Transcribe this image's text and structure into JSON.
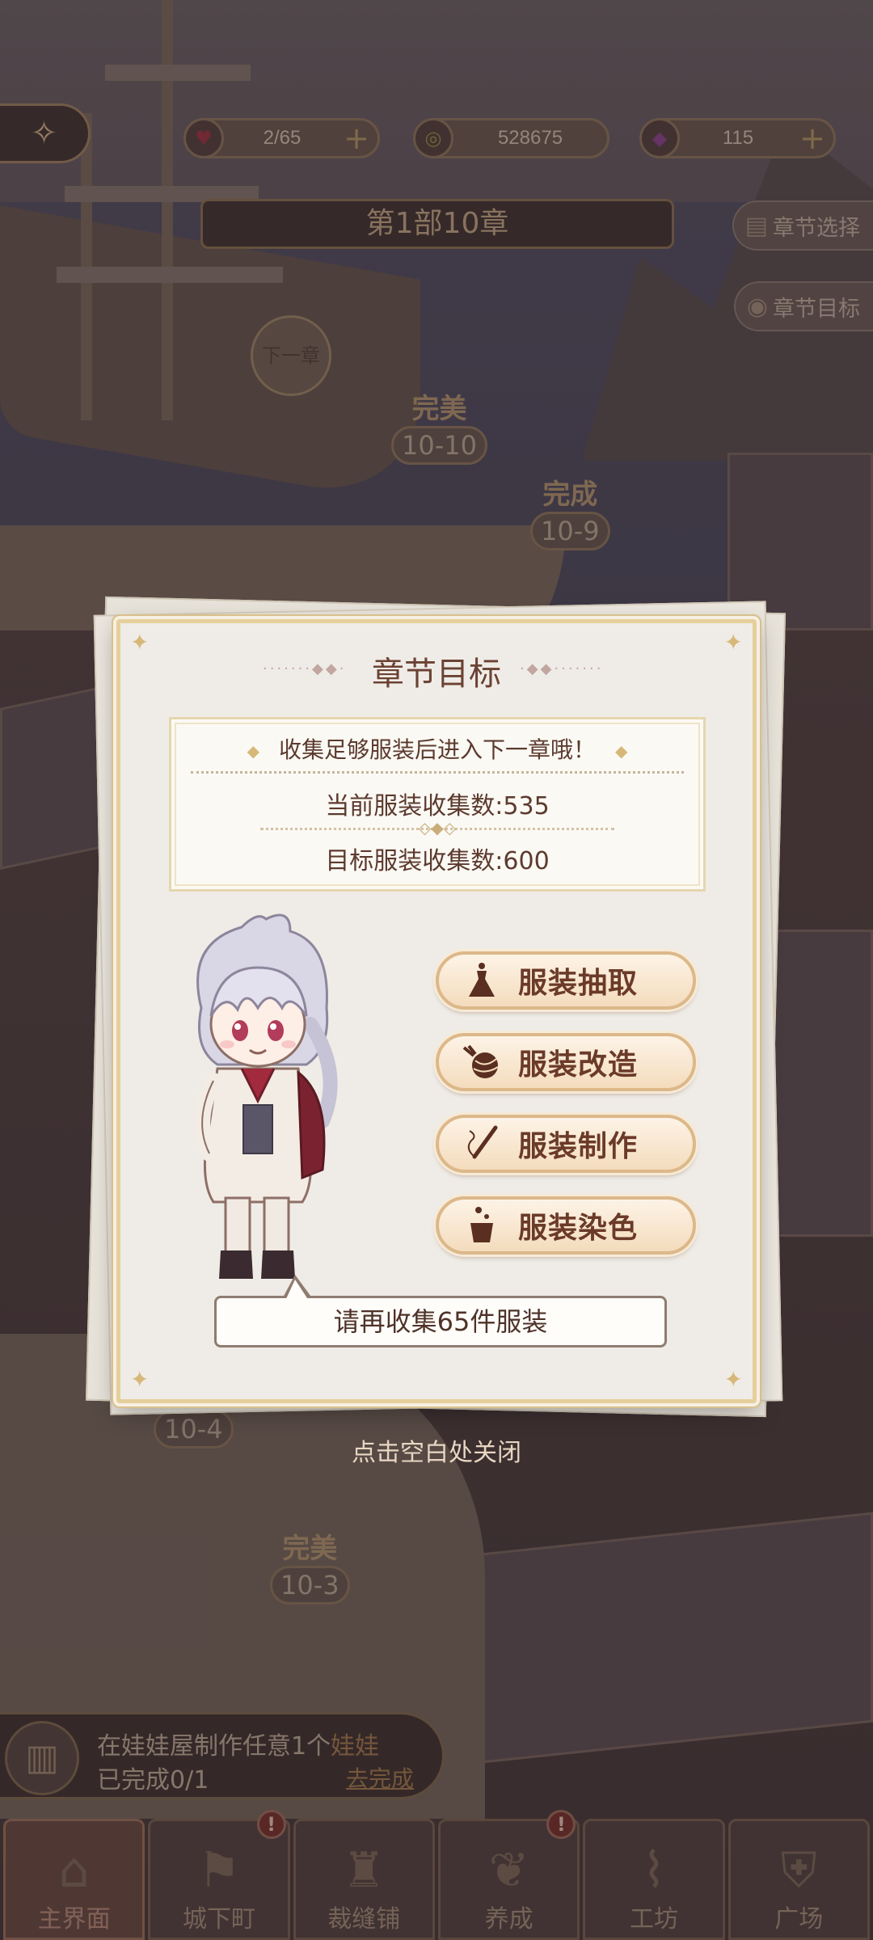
{
  "resources": [
    {
      "name": "stamina",
      "value": "2/65",
      "icon": "heart-icon",
      "color": "#8a2d3a"
    },
    {
      "name": "coins",
      "value": "528675",
      "icon": "coin-icon",
      "color": "#8a7a3a"
    },
    {
      "name": "gems",
      "value": "115",
      "icon": "gem-icon",
      "color": "#7a3a7a"
    }
  ],
  "chapter": {
    "title": "第1部10章",
    "select_label": "章节选择",
    "goal_label": "章节目标",
    "next_label": "下一章"
  },
  "stages": [
    {
      "label": "完美",
      "num": "10-10"
    },
    {
      "label": "完成",
      "num": "10-9"
    },
    {
      "label": "",
      "num": "10-4"
    },
    {
      "label": "完美",
      "num": "10-3"
    }
  ],
  "dialog": {
    "title": "章节目标",
    "tip": "收集足够服装后进入下一章哦！",
    "current": "当前服装收集数:535",
    "target": "目标服装收集数:600",
    "actions": [
      {
        "label": "服装抽取",
        "icon": "dress-icon"
      },
      {
        "label": "服装改造",
        "icon": "yarn-icon"
      },
      {
        "label": "服装制作",
        "icon": "needle-icon"
      },
      {
        "label": "服装染色",
        "icon": "dye-icon"
      }
    ],
    "speech": "请再收集65件服装",
    "close_hint": "点击空白处关闭"
  },
  "quest": {
    "text_prefix": "在娃娃屋制作任意1个",
    "text_highlight": "娃娃",
    "progress": "已完成0/1",
    "go_label": "去完成"
  },
  "nav": [
    {
      "label": "主界面",
      "icon": "home-icon",
      "badge": ""
    },
    {
      "label": "城下町",
      "icon": "flags-icon",
      "badge": "!"
    },
    {
      "label": "裁缝铺",
      "icon": "dress-form-icon",
      "badge": ""
    },
    {
      "label": "养成",
      "icon": "mermaid-icon",
      "badge": "!"
    },
    {
      "label": "工坊",
      "icon": "thread-spool-icon",
      "badge": ""
    },
    {
      "label": "广场",
      "icon": "shield-icon",
      "badge": ""
    }
  ]
}
